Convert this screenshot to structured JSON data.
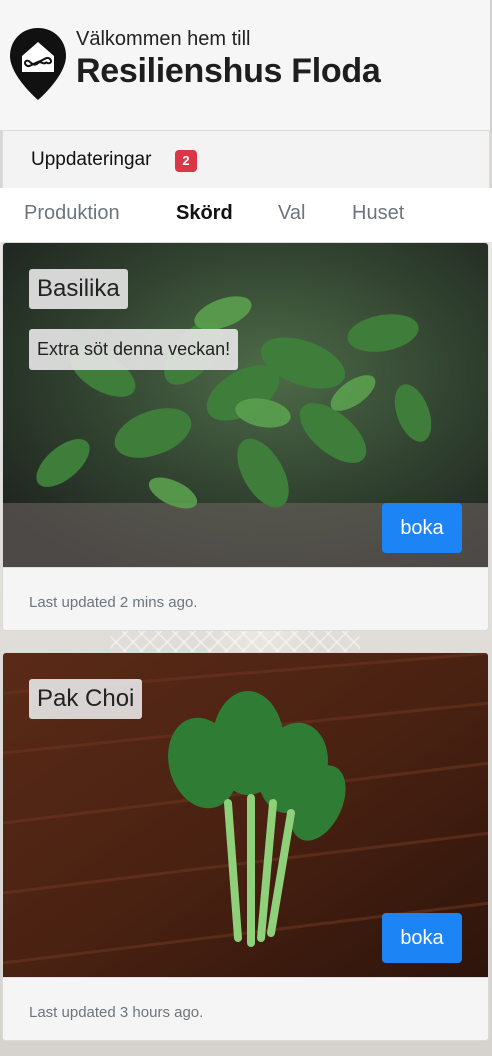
{
  "header": {
    "welcome": "Välkommen hem till",
    "brand": "Resilienshus Floda",
    "logo_icon": "house-infinity-pin-icon"
  },
  "updates": {
    "label": "Uppdateringar",
    "count": "2"
  },
  "tabs": [
    {
      "label": "Produktion",
      "active": false
    },
    {
      "label": "Skörd",
      "active": true
    },
    {
      "label": "Val",
      "active": false
    },
    {
      "label": "Huset",
      "active": false
    }
  ],
  "cards": [
    {
      "title": "Basilika",
      "description": "Extra söt denna veckan!",
      "button": "boka",
      "footer": "Last updated 2 mins ago.",
      "image": "basil-plant-photo"
    },
    {
      "title": "Pak Choi",
      "button": "boka",
      "footer": "Last updated 3 hours ago.",
      "image": "pak-choi-photo"
    }
  ],
  "colors": {
    "accent": "#1d84f5",
    "badge": "#dc3545"
  }
}
